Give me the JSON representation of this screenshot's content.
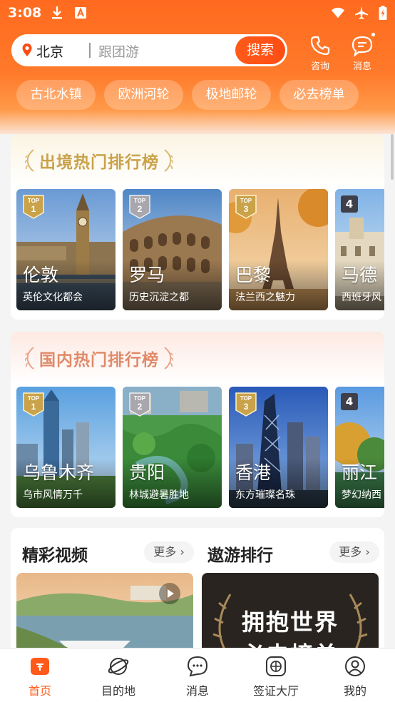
{
  "status": {
    "time": "3:08"
  },
  "search": {
    "city": "北京",
    "placeholder": "跟团游",
    "button": "搜索"
  },
  "header_actions": {
    "consult": "咨询",
    "messages": "消息"
  },
  "chips": [
    "古北水镇",
    "欧洲河轮",
    "极地邮轮",
    "必去榜单"
  ],
  "outbound": {
    "title": "出境热门排行榜",
    "cards": [
      {
        "rank": "1",
        "name": "伦敦",
        "desc": "英伦文化都会"
      },
      {
        "rank": "2",
        "name": "罗马",
        "desc": "历史沉淀之都"
      },
      {
        "rank": "3",
        "name": "巴黎",
        "desc": "法兰西之魅力"
      },
      {
        "rank": "4",
        "name": "马德",
        "desc": "西班牙风"
      }
    ]
  },
  "domestic": {
    "title": "国内热门排行榜",
    "cards": [
      {
        "rank": "1",
        "name": "乌鲁木齐",
        "desc": "乌市风情万千"
      },
      {
        "rank": "2",
        "name": "贵阳",
        "desc": "林城避暑胜地"
      },
      {
        "rank": "3",
        "name": "香港",
        "desc": "东方璀璨名珠"
      },
      {
        "rank": "4",
        "name": "丽江",
        "desc": "梦幻纳西"
      }
    ]
  },
  "videos": {
    "title": "精彩视频",
    "more": "更多"
  },
  "ranking": {
    "title": "遨游排行",
    "more": "更多",
    "poster_line1": "拥抱世界",
    "poster_line2": "必去榜单"
  },
  "tabs": [
    "首页",
    "目的地",
    "消息",
    "签证大厅",
    "我的"
  ],
  "colors": {
    "brand": "#ff5a1a",
    "header": "#ff7a2a",
    "gold": "#c9a24a"
  }
}
